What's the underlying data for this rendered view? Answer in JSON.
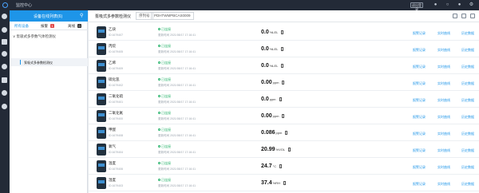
{
  "app": {
    "title": "监控中心",
    "quit_label": "退出登录"
  },
  "rail_icons": [
    "dashboard-icon",
    "monitor-icon",
    "device-icon",
    "alarm-icon",
    "location-icon",
    "chart-icon",
    "settings-icon",
    "user-icon"
  ],
  "sidebar": {
    "header": "设备在线列表(6)",
    "tabs": [
      {
        "label": "所有设备",
        "badge": ""
      },
      {
        "label": "报警",
        "badge": "1"
      },
      {
        "label": "离线",
        "badge": "0"
      }
    ],
    "group": "泵吸式多参数气体检测仪",
    "items": [
      {
        "label": "泵吸式多参数检测仪"
      }
    ]
  },
  "detail": {
    "title": "泵吸式多参数检测仪",
    "serial_label": "序列号",
    "serial_value": "PDHTWMPBCAS0009",
    "actions": [
      "报警记录",
      "实时曲线",
      "历史数据"
    ],
    "sensors": [
      {
        "name": "乙炔",
        "id": "ID:1679407",
        "status": "已连接",
        "updated": "更新时间 2021/08/17 17:16:41",
        "value": "0.0",
        "unit": "%LEL"
      },
      {
        "name": "丙烷",
        "id": "ID:1679405",
        "status": "已连接",
        "updated": "更新时间 2021/08/17 17:16:41",
        "value": "0.0",
        "unit": "%LEL"
      },
      {
        "name": "乙烯",
        "id": "ID:1679409",
        "status": "已连接",
        "updated": "更新时间 2021/08/17 17:16:41",
        "value": "0.0",
        "unit": "%LEL"
      },
      {
        "name": "硫化氢",
        "id": "ID:1679402",
        "status": "已连接",
        "updated": "更新时间 2021/08/17 17:16:41",
        "value": "0.00",
        "unit": "ppm"
      },
      {
        "name": "二氧化硫",
        "id": "ID:1679401",
        "status": "已连接",
        "updated": "更新时间 2021/08/17 17:16:41",
        "value": "0.0",
        "unit": "ppm"
      },
      {
        "name": "二氧化氮",
        "id": "ID:1679400",
        "status": "已连接",
        "updated": "更新时间 2021/08/17 17:16:41",
        "value": "0.00",
        "unit": "ppm"
      },
      {
        "name": "甲醛",
        "id": "ID:1679408",
        "status": "已连接",
        "updated": "更新时间 2021/08/17 17:16:41",
        "value": "0.086",
        "unit": "ppm"
      },
      {
        "name": "氧气",
        "id": "ID:1679404",
        "status": "已连接",
        "updated": "更新时间 2021/08/17 17:16:41",
        "value": "20.99",
        "unit": "%VOL"
      },
      {
        "name": "温度",
        "id": "ID:1679406",
        "status": "已连接",
        "updated": "更新时间 2021/08/17 17:16:41",
        "value": "24.7",
        "unit": "°C"
      },
      {
        "name": "湿度",
        "id": "ID:1679403",
        "status": "已连接",
        "updated": "更新时间 2021/08/17 17:16:41",
        "value": "37.4",
        "unit": "%RH"
      }
    ]
  },
  "colors": {
    "accent": "#1e95e8",
    "online": "#27b36a",
    "topbar": "#232a37"
  }
}
